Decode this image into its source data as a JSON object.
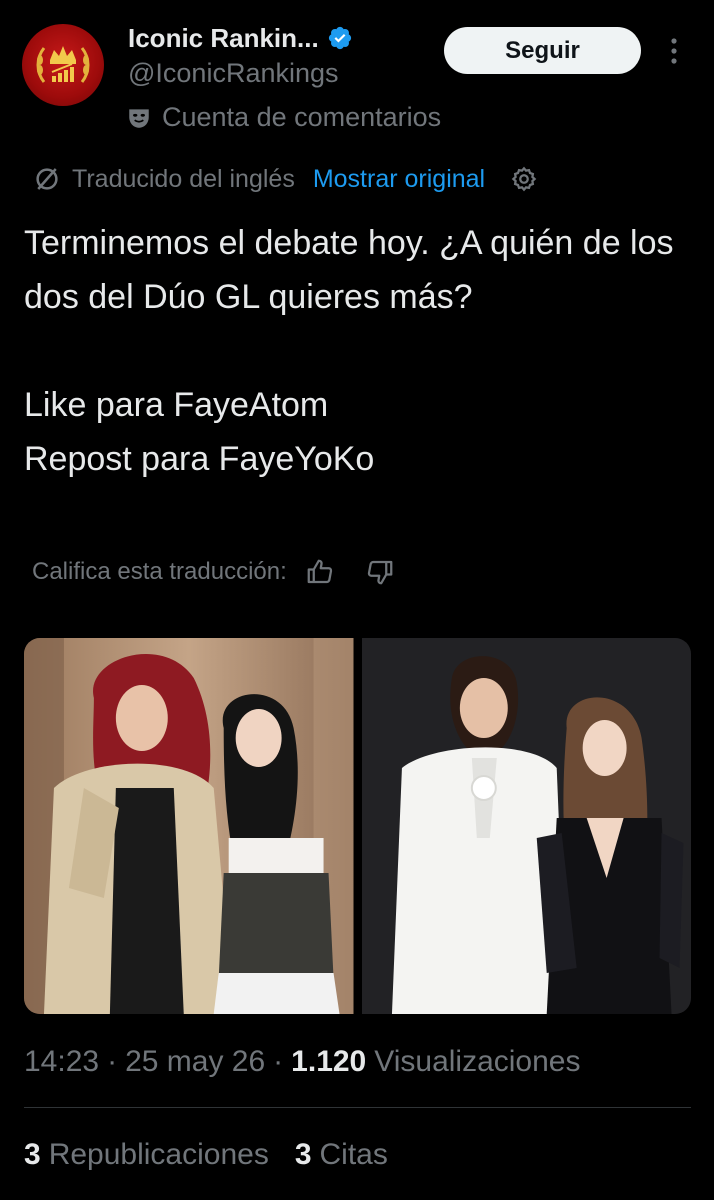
{
  "author": {
    "display_name": "Iconic Rankin...",
    "handle": "@IconicRankings",
    "account_label": "Cuenta de comentarios",
    "verified": true
  },
  "actions": {
    "follow_label": "Seguir"
  },
  "translation": {
    "translated_from": "Traducido del inglés",
    "show_original": "Mostrar original",
    "rate_prompt": "Califica esta traducción:"
  },
  "tweet": {
    "lines": [
      "Terminemos el debate hoy. ¿A quién de los dos del Dúo GL quieres más?",
      "Like para FayeAtom",
      "Repost para FayeYoKo"
    ]
  },
  "media": [
    {
      "icon": "photo-faye-atom"
    },
    {
      "icon": "photo-faye-yoko"
    }
  ],
  "meta": {
    "time": "14:23",
    "date": "25 may 26",
    "views_count": "1.120",
    "views_label": "Visualizaciones"
  },
  "stats": {
    "reposts_count": "3",
    "reposts_label": "Republicaciones",
    "quotes_count": "3",
    "quotes_label": "Citas"
  },
  "colors": {
    "background": "#000000",
    "text": "#e7e9ea",
    "muted": "#71767b",
    "link": "#1d9bf0",
    "verified": "#1d9bf0",
    "follow_bg": "#eff3f4"
  }
}
